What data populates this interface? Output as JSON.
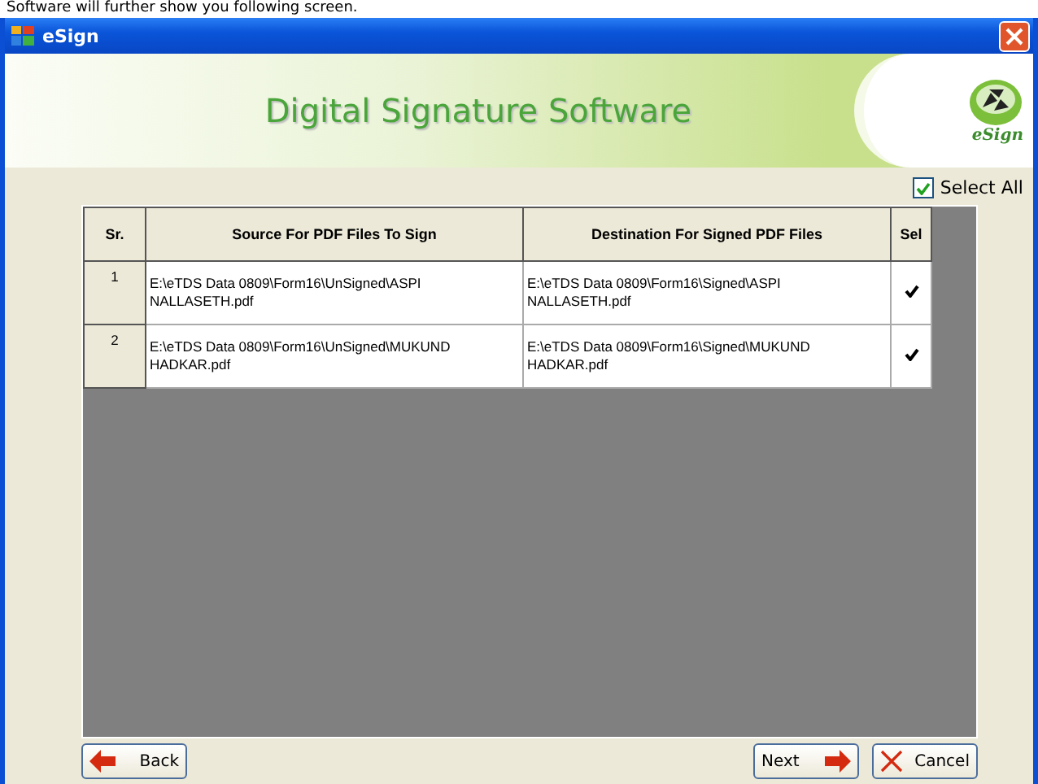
{
  "caption": "Software will further show you following screen.",
  "window": {
    "title": "eSign"
  },
  "banner": {
    "title": "Digital Signature Software",
    "logo_text": "eSign"
  },
  "select_all": {
    "label": "Select All",
    "checked": true
  },
  "table": {
    "columns": [
      "Sr.",
      "Source For PDF Files To Sign",
      "Destination For Signed PDF Files",
      "Sel"
    ],
    "rows": [
      {
        "sr": "1",
        "source": "E:\\eTDS Data 0809\\Form16\\UnSigned\\ASPI NALLASETH.pdf",
        "destination": "E:\\eTDS Data 0809\\Form16\\Signed\\ASPI NALLASETH.pdf",
        "checked": true
      },
      {
        "sr": "2",
        "source": "E:\\eTDS Data 0809\\Form16\\UnSigned\\MUKUND HADKAR.pdf",
        "destination": "E:\\eTDS Data 0809\\Form16\\Signed\\MUKUND HADKAR.pdf",
        "checked": true
      }
    ]
  },
  "buttons": [
    {
      "kind": "back",
      "label": "Back"
    },
    {
      "kind": "next",
      "label": "Next"
    },
    {
      "kind": "cancel",
      "label": "Cancel"
    }
  ]
}
